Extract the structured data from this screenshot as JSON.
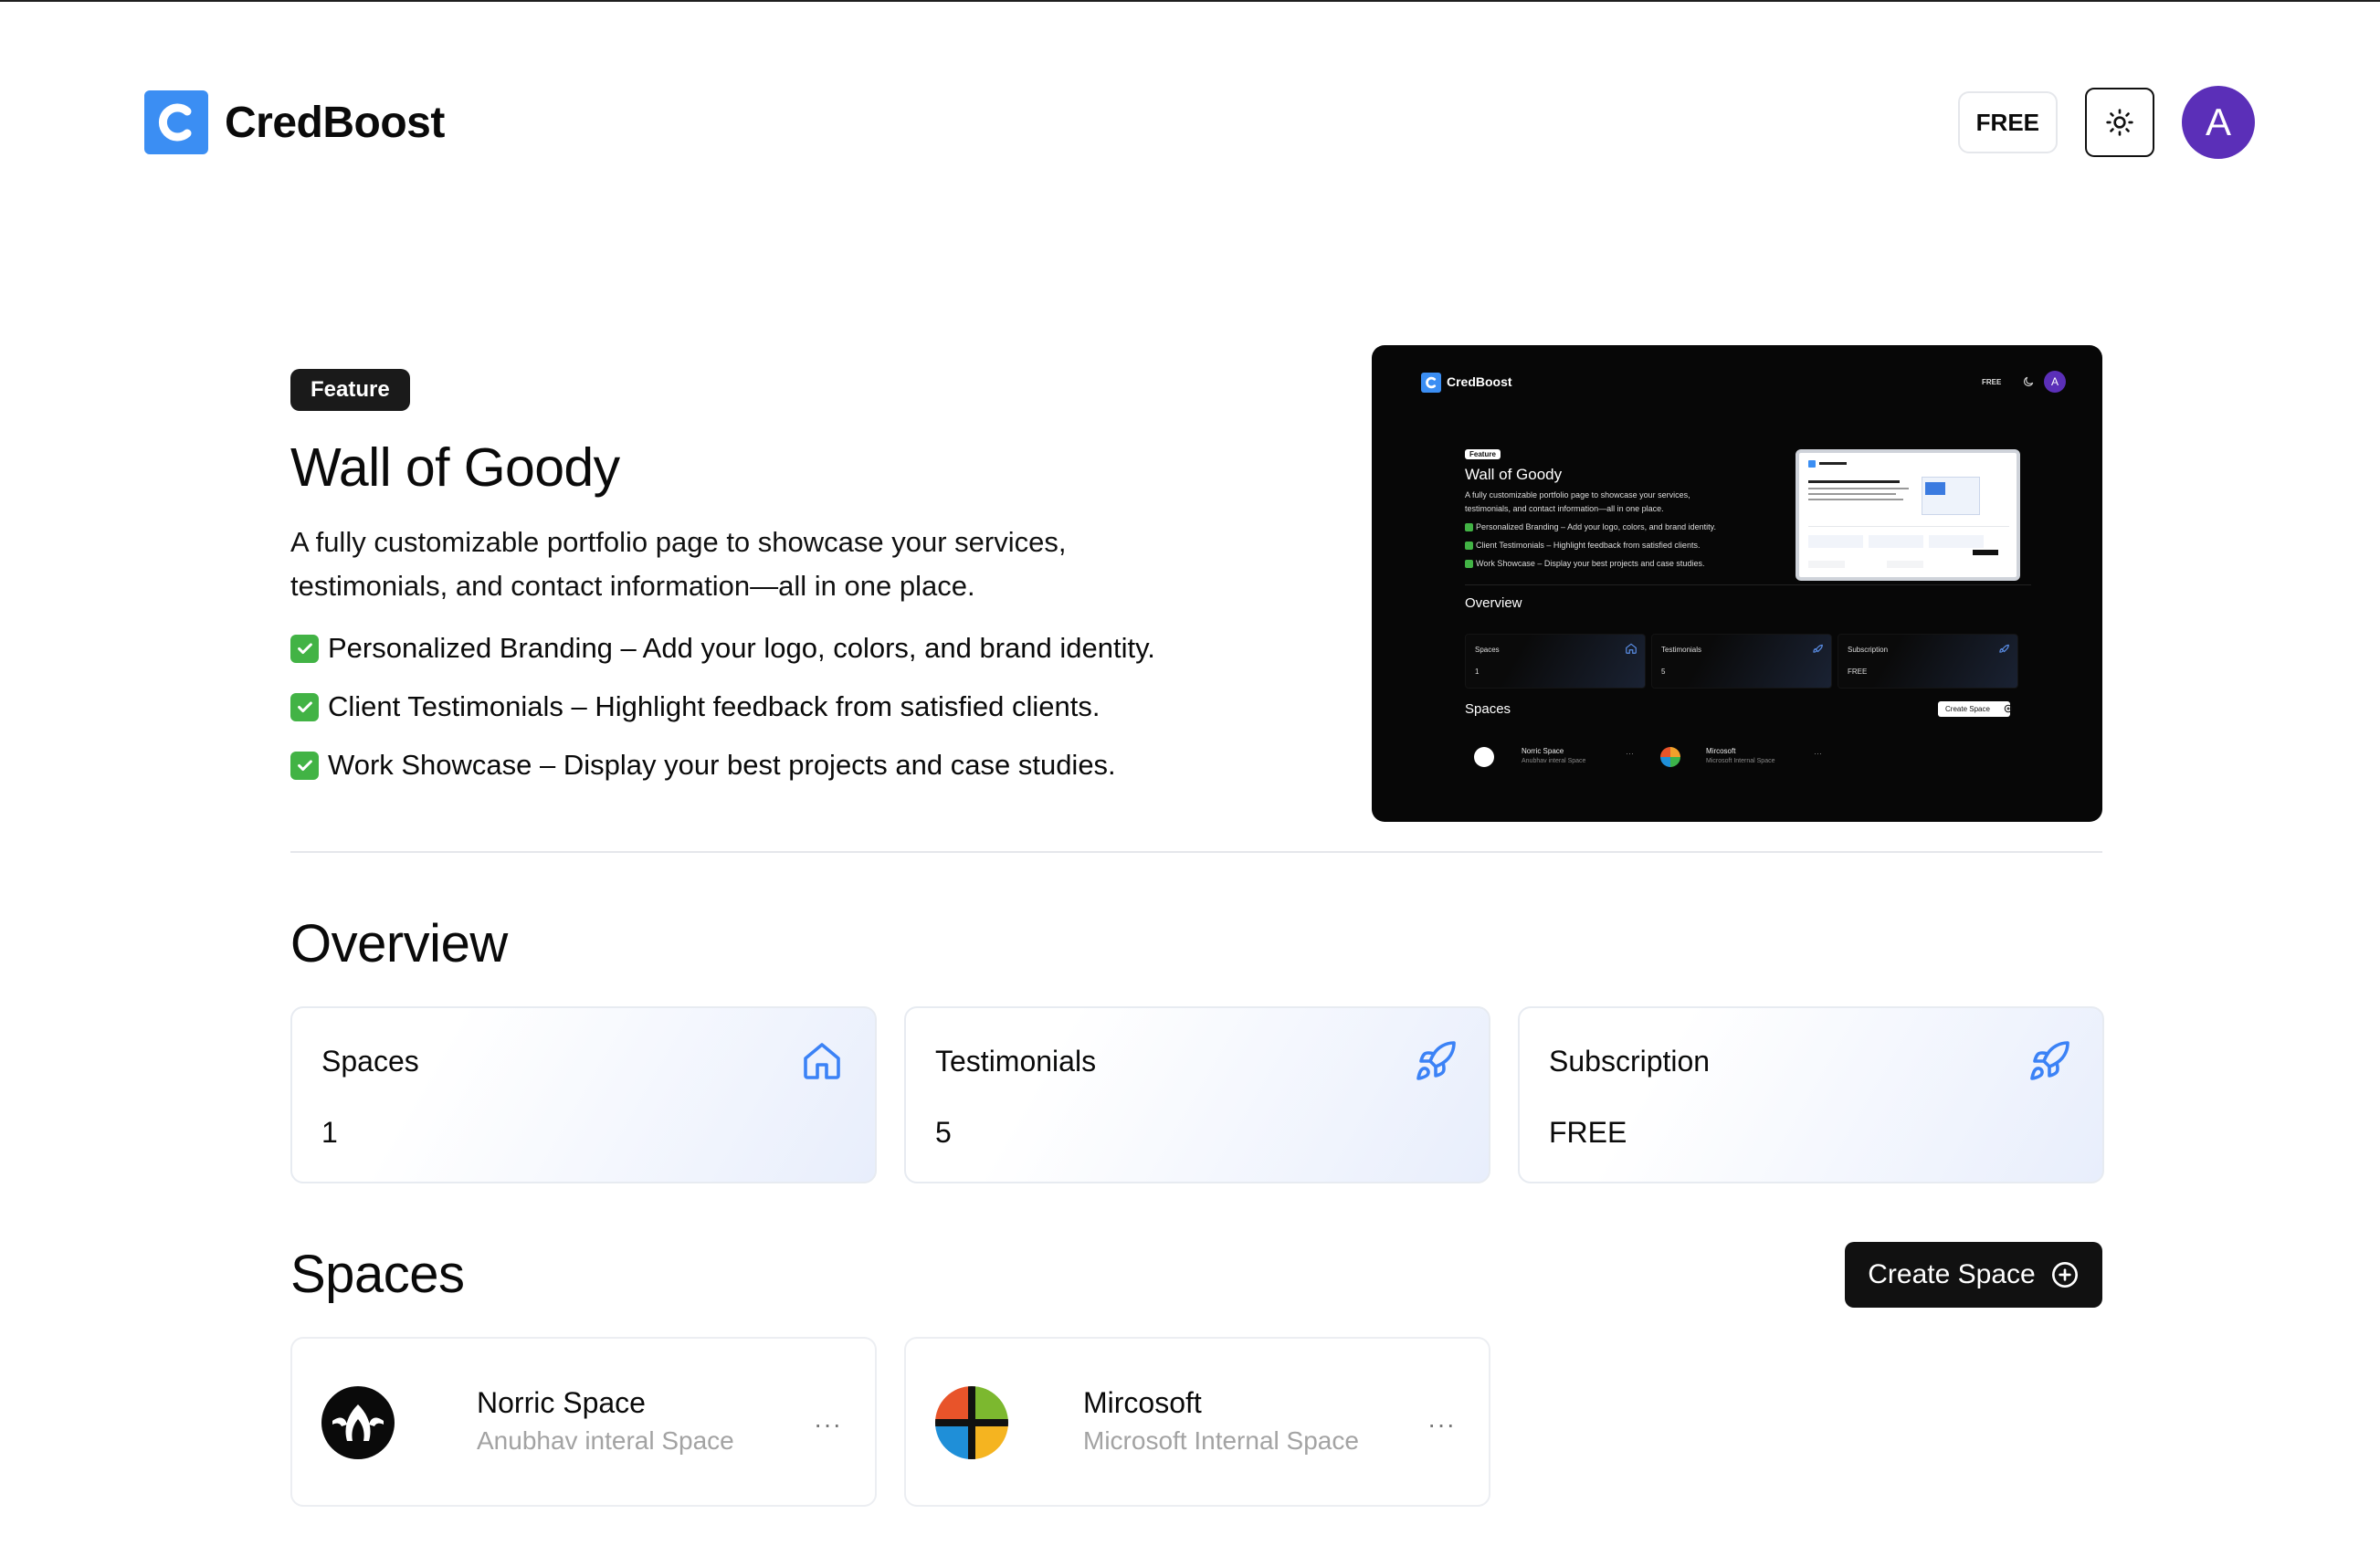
{
  "app": {
    "name": "CredBoost",
    "logo_letter": "C",
    "brand_color": "#3b8ef3"
  },
  "header": {
    "plan_label": "FREE",
    "theme_icon": "sun-icon",
    "avatar_letter": "A",
    "avatar_color": "#5b2fb8"
  },
  "feature": {
    "badge": "Feature",
    "title": "Wall of Goody",
    "description": "A fully customizable portfolio page to showcase your services, testimonials, and contact information—all in one place.",
    "bullets": [
      "Personalized Branding – Add your logo, colors, and brand identity.",
      "Client Testimonials – Highlight feedback from satisfied clients.",
      "Work Showcase – Display your best projects and case studies."
    ]
  },
  "preview": {
    "brand": "CredBoost",
    "plan": "FREE",
    "avatar": "A",
    "badge": "Feature",
    "title": "Wall of Goody",
    "desc_line1": "A fully customizable portfolio page to showcase your services,",
    "desc_line2": "testimonials, and contact information—all in one place.",
    "bullets": [
      "Personalized Branding – Add your logo, colors, and brand identity.",
      "Client Testimonials – Highlight feedback from satisfied clients.",
      "Work Showcase – Display your best projects and case studies."
    ],
    "overview": "Overview",
    "stats": [
      {
        "label": "Spaces",
        "value": "1"
      },
      {
        "label": "Testimonials",
        "value": "5"
      },
      {
        "label": "Subscription",
        "value": "FREE"
      }
    ],
    "spaces": "Spaces",
    "create": "Create Space",
    "space_cards": [
      {
        "name": "Norric Space",
        "sub": "Anubhav interal Space"
      },
      {
        "name": "Mircosoft",
        "sub": "Microsoft Internal Space"
      }
    ]
  },
  "overview": {
    "title": "Overview",
    "cards": [
      {
        "label": "Spaces",
        "value": "1",
        "icon": "home-icon"
      },
      {
        "label": "Testimonials",
        "value": "5",
        "icon": "rocket-icon"
      },
      {
        "label": "Subscription",
        "value": "FREE",
        "icon": "rocket-icon"
      }
    ]
  },
  "spaces": {
    "title": "Spaces",
    "create_label": "Create Space",
    "items": [
      {
        "name": "Norric Space",
        "subtitle": "Anubhav interal Space",
        "more": "···"
      },
      {
        "name": "Mircosoft",
        "subtitle": "Microsoft Internal Space",
        "more": "···"
      }
    ]
  },
  "colors": {
    "accent_icon": "#3b82f6",
    "check_green": "#42b345",
    "dark": "#111111"
  }
}
